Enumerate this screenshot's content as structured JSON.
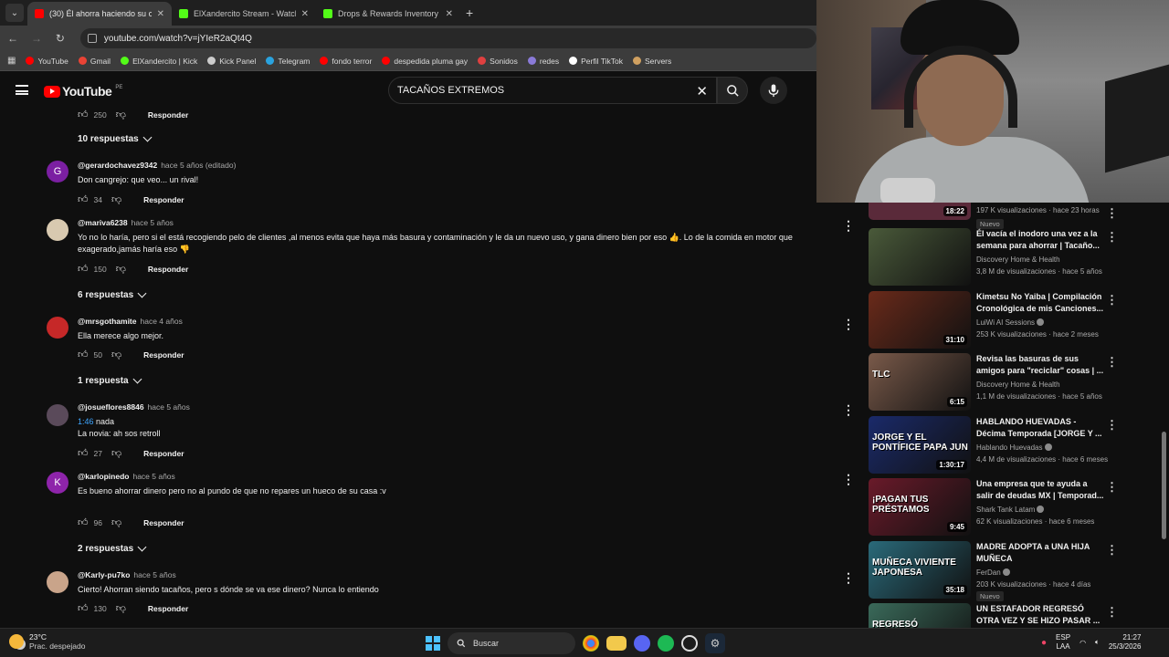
{
  "browser": {
    "tabs": [
      {
        "title": "(30) Él ahorra haciendo su comi",
        "fav": "#ff0000",
        "active": true
      },
      {
        "title": "ElXandercito Stream - Watch Li",
        "fav": "#53fc18",
        "active": false
      },
      {
        "title": "Drops & Rewards Inventory - K",
        "fav": "#53fc18",
        "active": false
      }
    ],
    "url": "youtube.com/watch?v=jYIeR2aQt4Q",
    "bookmarks": [
      {
        "label": "YouTube",
        "color": "#ff0000"
      },
      {
        "label": "Gmail",
        "color": "#ea4335"
      },
      {
        "label": "ElXandercito | Kick",
        "color": "#53fc18"
      },
      {
        "label": "Kick Panel",
        "color": "#cccccc"
      },
      {
        "label": "Telegram",
        "color": "#2aa3df"
      },
      {
        "label": "fondo terror",
        "color": "#ff0000"
      },
      {
        "label": "despedida pluma gay",
        "color": "#ff0000"
      },
      {
        "label": "Sonidos",
        "color": "#e04040"
      },
      {
        "label": "redes",
        "color": "#8a7ad8"
      },
      {
        "label": "Perfil TikTok",
        "color": "#ffffff"
      },
      {
        "label": "Servers",
        "color": "#d0a060"
      }
    ]
  },
  "youtube": {
    "logo": "YouTube",
    "region": "PE",
    "search_value": "TACAÑOS EXTREMOS"
  },
  "comments": {
    "top_row": {
      "likes": "250",
      "reply": "Responder"
    },
    "top_toggle": "10 respuestas",
    "items": [
      {
        "author": "@gerardochavez9342",
        "time": "hace 5 años (editado)",
        "text": "Don cangrejo: que veo... un rival!",
        "likes": "34",
        "reply": "Responder",
        "avatar_letter": "G",
        "avatar_color": "#7b1fa2",
        "toggle": ""
      },
      {
        "author": "@mariva6238",
        "time": "hace 5 años",
        "text": "Yo no lo haría, pero si el está recogiendo pelo de clientes ,al menos evita que haya más basura y contaminación y le da un nuevo uso, y  gana dinero bien por eso 👍. Lo de la comida en motor que exagerado,jamás haría eso 👎",
        "likes": "150",
        "reply": "Responder",
        "avatar_letter": "",
        "avatar_color": "#d8c9b0",
        "toggle": "6 respuestas"
      },
      {
        "author": "@mrsgothamite",
        "time": "hace 4 años",
        "text": "Ella merece algo mejor.",
        "likes": "50",
        "reply": "Responder",
        "avatar_letter": "",
        "avatar_color": "#c62828",
        "toggle": "1 respuesta"
      },
      {
        "author": "@josueflores8846",
        "time": "hace 5 años",
        "timestamp": "1:46",
        "text_after_ts": " nada",
        "text": "La novia: ah sos retroll",
        "likes": "27",
        "reply": "Responder",
        "avatar_letter": "",
        "avatar_color": "#5a4a5a",
        "toggle": ""
      },
      {
        "author": "@karlopinedo",
        "time": "hace 5 años",
        "text": "Es bueno ahorrar dinero pero no al pundo de que no repares un hueco de su casa :v",
        "likes": "96",
        "reply": "Responder",
        "avatar_letter": "K",
        "avatar_color": "#8e24aa",
        "toggle": "2 respuestas"
      },
      {
        "author": "@Karly-pu7ko",
        "time": "hace 5 años",
        "text": "Cierto! Ahorran siendo tacaños, pero s dónde se va ese dinero? Nunca lo entiendo",
        "likes": "130",
        "reply": "Responder",
        "avatar_letter": "",
        "avatar_color": "#c9a48a",
        "toggle": ""
      }
    ]
  },
  "sidebar": {
    "first_partial": {
      "duration": "18:22",
      "meta": "197 K visualizaciones · hace 23 horas",
      "badge": "Nuevo"
    },
    "videos": [
      {
        "title": "Él vacía el inodoro una vez a la semana para ahorrar | Tacaño...",
        "channel": "Discovery Home & Health",
        "meta": "3,8 M de visualizaciones · hace 5 años",
        "duration": "",
        "thumb": "#4a5a3a",
        "caption": "",
        "verified": false,
        "badge": ""
      },
      {
        "title": "Kimetsu No Yaiba | Compilación Cronológica de mis Canciones...",
        "channel": "LuiWi AI Sessions",
        "meta": "253 K visualizaciones · hace 2 meses",
        "duration": "31:10",
        "thumb": "#6a2a1a",
        "caption": "",
        "verified": true,
        "badge": ""
      },
      {
        "title": "Revisa las basuras de sus amigos para \"reciclar\" cosas | ...",
        "channel": "Discovery Home & Health",
        "meta": "1,1 M de visualizaciones · hace 5 años",
        "duration": "6:15",
        "thumb": "#7a5a4a",
        "caption": "TLC",
        "verified": false,
        "badge": ""
      },
      {
        "title": "HABLANDO HUEVADAS - Décima Temporada [JORGE Y ...",
        "channel": "Hablando Huevadas",
        "meta": "4,4 M de visualizaciones · hace 6 meses",
        "duration": "1:30:17",
        "thumb": "#1a2a6a",
        "caption": "JORGE Y EL PONTÍFICE PAPA JUN",
        "verified": true,
        "badge": ""
      },
      {
        "title": "Una empresa que te ayuda a salir de deudas MX | Temporad...",
        "channel": "Shark Tank Latam",
        "meta": "62 K visualizaciones · hace 6 meses",
        "duration": "9:45",
        "thumb": "#6a1a2a",
        "caption": "¡PAGAN TUS PRÉSTAMOS",
        "verified": true,
        "badge": ""
      },
      {
        "title": "MADRE ADOPTA a UNA HIJA MUÑECA",
        "channel": "FerDan",
        "meta": "203 K visualizaciones · hace 4 días",
        "duration": "35:18",
        "thumb": "#2a6a7a",
        "caption": "MUÑECA VIVIENTE JAPONESA",
        "verified": true,
        "badge": "Nuevo"
      },
      {
        "title": "UN ESTAFADOR REGRESÓ OTRA VEZ Y SE HIZO PASAR ...",
        "channel": "",
        "meta": "",
        "duration": "",
        "thumb": "#3a6a5a",
        "caption": "REGRESÓ",
        "verified": false,
        "badge": ""
      }
    ]
  },
  "taskbar": {
    "temp": "23°C",
    "weather": "Prac. despejado",
    "search": "Buscar",
    "lang1": "ESP",
    "lang2": "LAA",
    "time": "21:27",
    "date": "25/3/2026"
  }
}
